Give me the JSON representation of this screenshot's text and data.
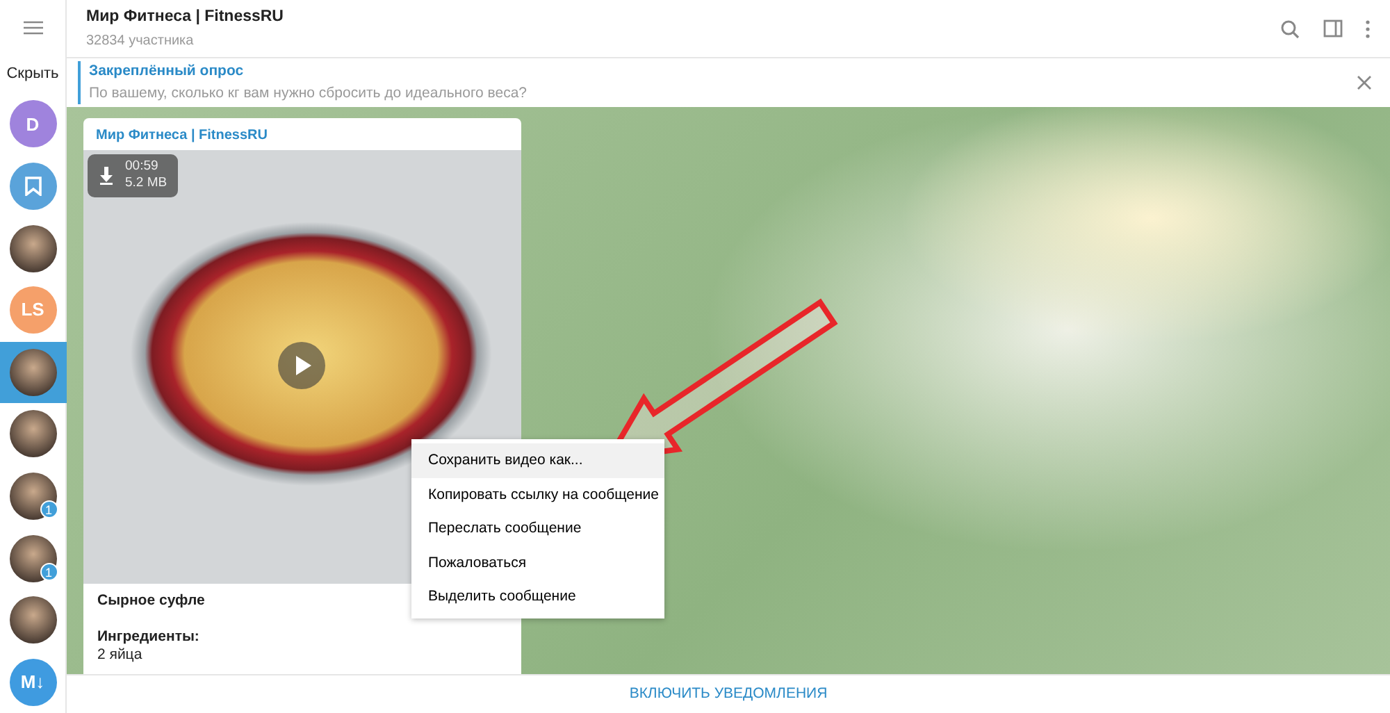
{
  "sidebar": {
    "hide_label": "Скрыть",
    "chats": [
      {
        "kind": "letter",
        "text": "D",
        "color": "#9f83dd",
        "selected": false
      },
      {
        "kind": "bookmark",
        "color": "#5aa3da",
        "selected": false
      },
      {
        "kind": "photo",
        "selected": false
      },
      {
        "kind": "letter",
        "text": "LS",
        "color": "#f5a06a",
        "selected": false
      },
      {
        "kind": "photo",
        "selected": true
      },
      {
        "kind": "photo",
        "selected": false
      },
      {
        "kind": "photo",
        "selected": false,
        "badge": "1"
      },
      {
        "kind": "photo",
        "selected": false,
        "badge": "1"
      },
      {
        "kind": "photo",
        "selected": false
      },
      {
        "kind": "letter",
        "text": "M↓",
        "color": "#3f9be0",
        "selected": false
      }
    ]
  },
  "header": {
    "title": "Мир Фитнеса | FitnessRU",
    "subtitle": "32834 участника"
  },
  "pinned": {
    "title": "Закреплённый опрос",
    "text": "По вашему, сколько кг вам нужно сбросить до идеального веса?"
  },
  "message": {
    "author": "Мир Фитнеса | FitnessRU",
    "video": {
      "duration": "00:59",
      "size": "5.2 MB"
    },
    "lines": [
      {
        "text": "Сырное суфле",
        "bold": true,
        "space_before": false
      },
      {
        "text": "Ингредиенты:",
        "bold": true,
        "space_before": true
      },
      {
        "text": "2 яйца",
        "bold": false,
        "space_before": false
      }
    ]
  },
  "context_menu": [
    {
      "label": "Сохранить видео как...",
      "selected": true
    },
    {
      "label": "Копировать ссылку на сообщение",
      "selected": false
    },
    {
      "label": "Переслать сообщение",
      "selected": false
    },
    {
      "label": "Пожаловаться",
      "selected": false
    },
    {
      "label": "Выделить сообщение",
      "selected": false
    }
  ],
  "footer": {
    "button": "ВКЛЮЧИТЬ УВЕДОМЛЕНИЯ"
  }
}
